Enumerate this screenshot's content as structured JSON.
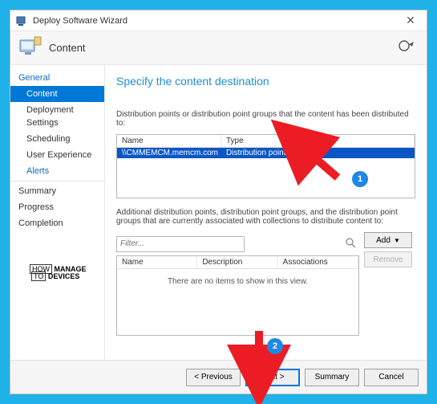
{
  "window": {
    "title": "Deploy Software Wizard",
    "close": "✕"
  },
  "header": {
    "title": "Content"
  },
  "nav": {
    "items": [
      {
        "label": "General",
        "selected": false,
        "sub": false,
        "link": true
      },
      {
        "label": "Content",
        "selected": true,
        "sub": true,
        "link": false
      },
      {
        "label": "Deployment Settings",
        "selected": false,
        "sub": true,
        "link": false
      },
      {
        "label": "Scheduling",
        "selected": false,
        "sub": true,
        "link": false
      },
      {
        "label": "User Experience",
        "selected": false,
        "sub": true,
        "link": false
      },
      {
        "label": "Alerts",
        "selected": false,
        "sub": true,
        "link": true
      },
      {
        "label": "Summary",
        "selected": false,
        "sub": false,
        "link": false
      },
      {
        "label": "Progress",
        "selected": false,
        "sub": false,
        "link": false
      },
      {
        "label": "Completion",
        "selected": false,
        "sub": false,
        "link": false
      }
    ]
  },
  "main": {
    "page_title": "Specify the content destination",
    "dist_desc": "Distribution points or distribution point groups that the content has been distributed to:",
    "columns": {
      "name": "Name",
      "type": "Type",
      "desc": "Description",
      "assoc": "Associations"
    },
    "row": {
      "name": "\\\\CMMEMCM.memcm.com",
      "type": "Distribution point"
    },
    "add_desc": "Additional distribution points, distribution point groups, and the distribution point groups that are currently associated with collections to distribute content to:",
    "filter_placeholder": "Filter...",
    "add_label": "Add",
    "remove_label": "Remove",
    "empty_msg": "There are no items to show in this view."
  },
  "footer": {
    "previous": "< Previous",
    "next": "Next >",
    "summary": "Summary",
    "cancel": "Cancel"
  },
  "logo": {
    "l1": "HOW",
    "l2": "MANAGE",
    "l3": "TO",
    "l4": "DEVICES"
  },
  "badges": {
    "one": "1",
    "two": "2"
  }
}
